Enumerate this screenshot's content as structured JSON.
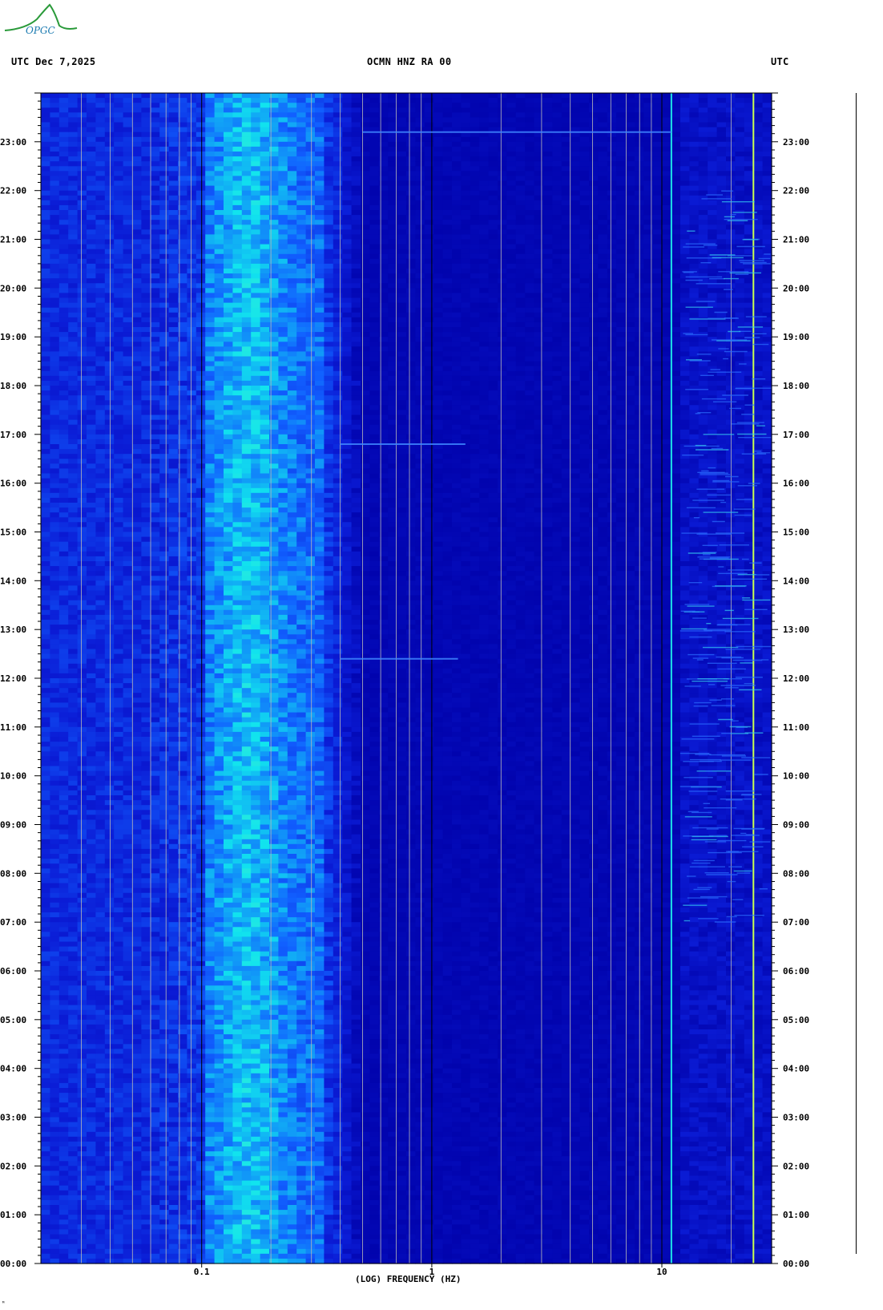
{
  "header": {
    "left": "UTC  Dec 7,2025",
    "center": "OCMN HNZ RA 00",
    "right": "UTC"
  },
  "logo": {
    "text": "OPGC",
    "color": "#2a9a3a"
  },
  "colors": {
    "background": "#0000a8",
    "low": "#0b1cd6",
    "mid": "#1160ff",
    "high": "#11e4ee",
    "peak": "#7cff9a",
    "grid": "#b8b8b8"
  },
  "chart_data": {
    "type": "heatmap",
    "title": "OCMN HNZ RA 00",
    "xlabel": "(LOG) FREQUENCY (HZ)",
    "ylabel": "UTC",
    "x_scale": "log",
    "x_range": [
      0.02,
      30
    ],
    "x_ticks": [
      {
        "value": 0.1,
        "label": "0.1"
      },
      {
        "value": 1,
        "label": "1"
      },
      {
        "value": 10,
        "label": "10"
      }
    ],
    "y_range_hours": [
      0,
      24
    ],
    "y_ticks": [
      "00:00",
      "01:00",
      "02:00",
      "03:00",
      "04:00",
      "05:00",
      "06:00",
      "07:00",
      "08:00",
      "09:00",
      "10:00",
      "11:00",
      "12:00",
      "13:00",
      "14:00",
      "15:00",
      "16:00",
      "17:00",
      "18:00",
      "19:00",
      "20:00",
      "21:00",
      "22:00",
      "23:00"
    ],
    "grid_frequencies": [
      0.03,
      0.04,
      0.05,
      0.06,
      0.07,
      0.08,
      0.09,
      0.1,
      0.2,
      0.3,
      0.4,
      0.5,
      0.6,
      0.7,
      0.8,
      0.9,
      1,
      2,
      3,
      4,
      5,
      6,
      7,
      8,
      9,
      10,
      20,
      30
    ],
    "features": [
      {
        "kind": "microseism band",
        "freq_range_hz": [
          0.1,
          0.35
        ],
        "note": "strongest energy near 0.13–0.2 Hz"
      },
      {
        "kind": "tonal line",
        "freq_hz": 11,
        "color": "#1ee0e6"
      },
      {
        "kind": "tonal line",
        "freq_hz": 25,
        "color": "#c8ff50"
      },
      {
        "kind": "broadband noise",
        "freq_range_hz": [
          12,
          30
        ],
        "time_range_hours": [
          7,
          22
        ]
      },
      {
        "kind": "transient",
        "time_hours": 23.2,
        "freq_range_hz": [
          0.5,
          11
        ]
      },
      {
        "kind": "transient",
        "time_hours": 12.4,
        "freq_range_hz": [
          0.4,
          1.3
        ]
      },
      {
        "kind": "transient",
        "time_hours": 16.8,
        "freq_range_hz": [
          0.4,
          1.4
        ]
      }
    ]
  },
  "xaxis": {
    "title": "(LOG) FREQUENCY (HZ)"
  }
}
